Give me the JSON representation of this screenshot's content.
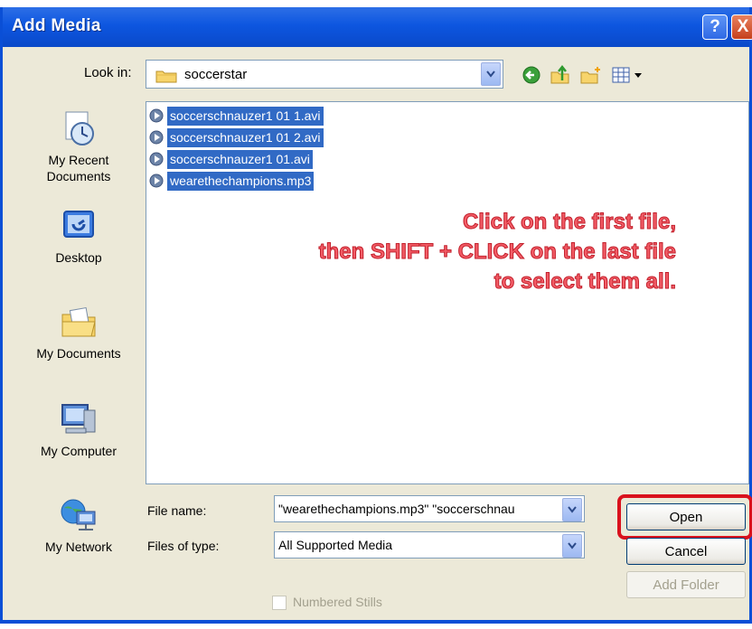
{
  "window": {
    "title": "Add Media",
    "help_label": "?",
    "close_label": "X"
  },
  "look_in": {
    "label": "Look in:",
    "value": "soccerstar"
  },
  "places": [
    {
      "label_lines": [
        "My Recent",
        "Documents"
      ],
      "icon": "recent-documents-icon"
    },
    {
      "label_lines": [
        "Desktop"
      ],
      "icon": "desktop-icon"
    },
    {
      "label_lines": [
        "My Documents"
      ],
      "icon": "my-documents-icon"
    },
    {
      "label_lines": [
        "My Computer"
      ],
      "icon": "my-computer-icon"
    },
    {
      "label_lines": [
        "My Network"
      ],
      "icon": "my-network-icon"
    }
  ],
  "files": [
    {
      "name": "soccerschnauzer1 01 1.avi",
      "selected": true
    },
    {
      "name": "soccerschnauzer1 01 2.avi",
      "selected": true
    },
    {
      "name": "soccerschnauzer1 01.avi",
      "selected": true
    },
    {
      "name": "wearethechampions.mp3",
      "selected": true
    }
  ],
  "instruction": {
    "line1": "Click on the first file,",
    "line2": "then SHIFT + CLICK on the last file",
    "line3": "to select them all."
  },
  "file_name": {
    "label": "File name:",
    "value": "\"wearethechampions.mp3\" \"soccerschnau"
  },
  "file_type": {
    "label": "Files of type:",
    "value": "All Supported Media"
  },
  "buttons": {
    "open": "Open",
    "cancel": "Cancel",
    "add_folder": "Add Folder"
  },
  "numbered_stills": {
    "label": "Numbered Stills",
    "checked": false,
    "enabled": false
  },
  "colors": {
    "title_bar": "#0d56e0",
    "selection": "#316ac5",
    "highlight": "#d9121d",
    "instruction_text": "#f25c66"
  }
}
